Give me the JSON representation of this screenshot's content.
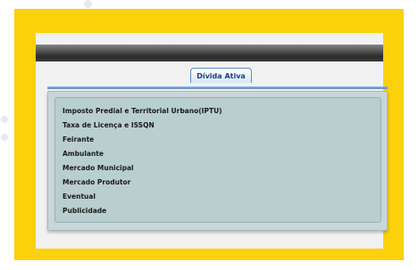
{
  "tab": {
    "label": "Dívida Ativa"
  },
  "menu": {
    "items": [
      "Imposto Predial e Territorial Urbano(IPTU)",
      "Taxa de Licença e ISSQN",
      "Feirante",
      "Ambulante",
      "Mercado Municipal",
      "Mercado Produtor",
      "Eventual",
      "Publicidade"
    ]
  },
  "colors": {
    "frame": "#fad10a",
    "tab_text": "#1b3f8f",
    "panel": "#c9d6d9"
  }
}
